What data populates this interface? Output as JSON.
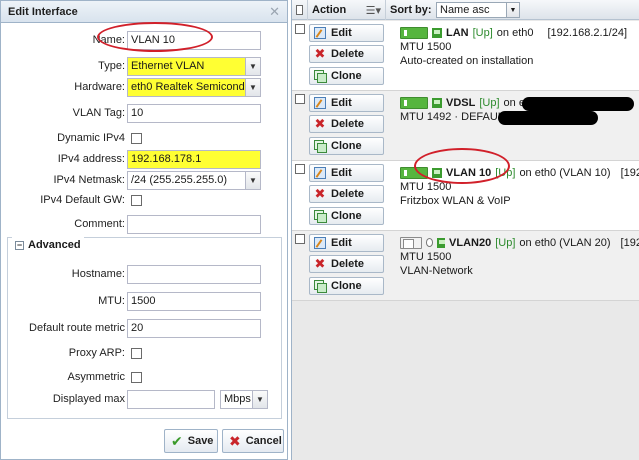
{
  "window": {
    "title": "Edit Interface"
  },
  "form": {
    "name_label": "Name:",
    "name_value": "VLAN 10",
    "type_label": "Type:",
    "type_value": "Ethernet VLAN",
    "hardware_label": "Hardware:",
    "hardware_value": "eth0 Realtek Semiconduc",
    "vlantag_label": "VLAN Tag:",
    "vlantag_value": "10",
    "dhcp_label": "Dynamic IPv4",
    "ipv4_label": "IPv4 address:",
    "ipv4_value": "192.168.178.1",
    "netmask_label": "IPv4 Netmask:",
    "netmask_value": "/24 (255.255.255.0)",
    "gw_label": "IPv4 Default GW:",
    "comment_label": "Comment:",
    "comment_value": ""
  },
  "advanced": {
    "title": "Advanced",
    "collapse_glyph": "−",
    "hostname_label": "Hostname:",
    "hostname_value": "",
    "mtu_label": "MTU:",
    "mtu_value": "1500",
    "metric_label": "Default route metric",
    "metric_value": "20",
    "proxyarp_label": "Proxy ARP:",
    "asym_label": "Asymmetric",
    "maxdisp_label": "Displayed max",
    "maxdisp_value": "",
    "unit_value": "Mbps"
  },
  "buttons": {
    "save": "Save",
    "cancel": "Cancel"
  },
  "grid": {
    "action_header": "Action",
    "sortby_label": "Sort by:",
    "sortby_value": "Name asc",
    "rows": [
      {
        "edit": "Edit",
        "delete": "Delete",
        "clone": "Clone",
        "name": "LAN",
        "status": "[Up]",
        "device": "on eth0",
        "ip": "[192.168.2.1/24]",
        "mtu": "MTU 1500",
        "desc": "Auto-created on installation"
      },
      {
        "edit": "Edit",
        "delete": "Delete",
        "clone": "Clone",
        "name": "VDSL",
        "status": "[Up]",
        "device": "on eth1",
        "ip": "",
        "mtu": "MTU 1492 · DEFAULT GW",
        "desc": ""
      },
      {
        "edit": "Edit",
        "delete": "Delete",
        "clone": "Clone",
        "name": "VLAN 10",
        "status": "[Up]",
        "device": "on eth0 (VLAN 10)",
        "ip": "[192",
        "mtu": "MTU 1500",
        "desc": "Fritzbox WLAN & VoIP"
      },
      {
        "edit": "Edit",
        "delete": "Delete",
        "clone": "Clone",
        "name": "VLAN20",
        "status": "[Up]",
        "device": "on eth0 (VLAN 20)",
        "ip": "[192.",
        "mtu": "MTU 1500",
        "desc": "VLAN-Network"
      }
    ]
  },
  "icons": {
    "close": "close-icon",
    "edit": "edit-icon",
    "delete": "delete-icon",
    "clone": "clone-icon",
    "save": "check-icon",
    "cancel": "x-icon",
    "menu": "list-menu-icon",
    "dropdown": "chevron-down-icon"
  },
  "colors": {
    "highlight": "#ffff33",
    "status_up": "#2c8a2c",
    "annotation": "#d1202a",
    "delete": "#c9252a"
  }
}
